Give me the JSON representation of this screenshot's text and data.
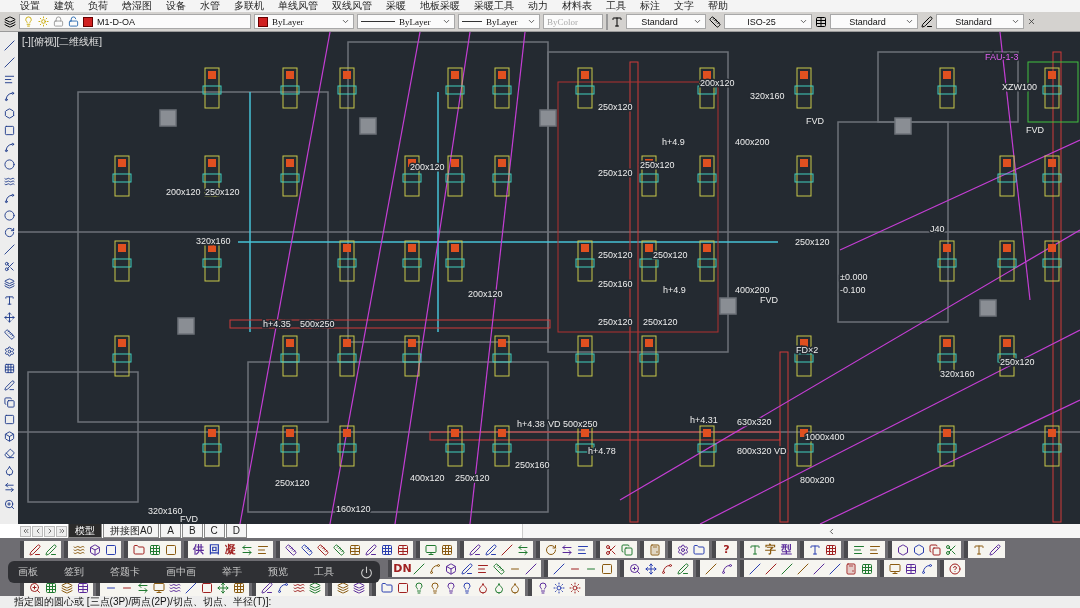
{
  "menu": [
    "设置",
    "建筑",
    "负荷",
    "焓湿图",
    "设备",
    "水管",
    "多联机",
    "单线风管",
    "双线风管",
    "采暖",
    "地板采暖",
    "采暖工具",
    "动力",
    "材料表",
    "工具",
    "标注",
    "文字",
    "帮助"
  ],
  "properties": {
    "layer": "M1-D-OA",
    "color_setting": "ByLayer",
    "linetype": "ByLayer",
    "lineweight": "ByLayer",
    "plot_style": {
      "value": "ByColor",
      "disabled": true
    }
  },
  "styles": [
    {
      "value": "Standard"
    },
    {
      "value": "ISO-25"
    },
    {
      "value": "Standard"
    },
    {
      "value": "Standard"
    }
  ],
  "viewport_label": "[-][俯视][二维线框]",
  "drawing_labels": [
    "FAU-1-3",
    "XZW100",
    "FVD",
    "FVD",
    "200x120",
    "320x160",
    "250x120",
    "h+4.9",
    "400x200",
    "250x120",
    "250x120",
    "200x120",
    "200x120",
    "250x120",
    "320x160",
    "250x120",
    "250x120",
    "250x120",
    "400x200",
    "250x160",
    "200x120",
    "h+4.9",
    "FVD",
    "h+4.35",
    "500x250",
    "250x120",
    "250x120",
    "FD×2",
    "320x160",
    "250x120",
    "h+4.38",
    "VD 500x250",
    "h+4.31",
    "630x320",
    "1000x400",
    "h+4.78",
    "800x320 VD",
    "250x160",
    "250x120",
    "400x120",
    "250x120",
    "800x200",
    "320x160",
    "FVD",
    "160x120",
    "J40",
    "±0.000",
    "-0.100"
  ],
  "layout_tabs": [
    {
      "label": "模型",
      "selected": true
    },
    {
      "label": "拼接图A0",
      "selected": false
    },
    {
      "label": "A",
      "selected": false
    },
    {
      "label": "B",
      "selected": false
    },
    {
      "label": "C",
      "selected": false
    },
    {
      "label": "D",
      "selected": false
    }
  ],
  "toolbar_labels": [
    "供",
    "回",
    "凝",
    "?",
    "字",
    "型",
    "DN"
  ],
  "meeting_bar": [
    "画板",
    "签到",
    "答题卡",
    "画中画",
    "举手",
    "预览",
    "工具"
  ],
  "command_line": "指定圆的圆心或 [三点(3P)/两点(2P)/切点、切点、半径(T)]:"
}
